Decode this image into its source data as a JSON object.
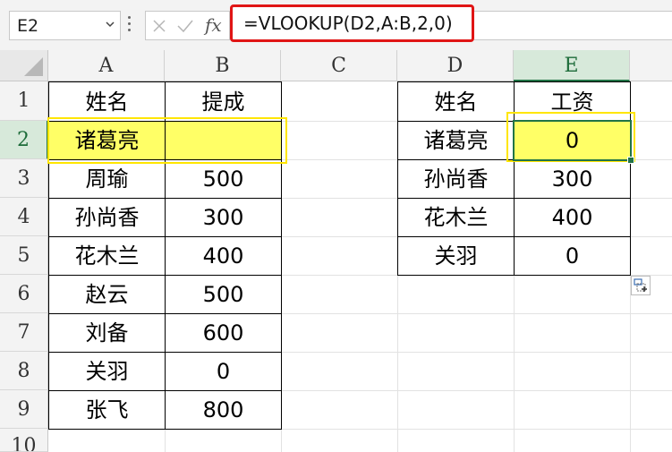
{
  "formula_bar": {
    "name_box": "E2",
    "fx_label": "fx",
    "formula": "=VLOOKUP(D2,A:B,2,0)"
  },
  "columns": [
    "A",
    "B",
    "C",
    "D",
    "E"
  ],
  "rows": [
    "1",
    "2",
    "3",
    "4",
    "5",
    "6",
    "7",
    "8",
    "9",
    "10"
  ],
  "table_left": {
    "headers": [
      "姓名",
      "提成"
    ],
    "rows": [
      [
        "诸葛亮",
        ""
      ],
      [
        "周瑜",
        "500"
      ],
      [
        "孙尚香",
        "300"
      ],
      [
        "花木兰",
        "400"
      ],
      [
        "赵云",
        "500"
      ],
      [
        "刘备",
        "600"
      ],
      [
        "关羽",
        "0"
      ],
      [
        "张飞",
        "800"
      ]
    ]
  },
  "table_right": {
    "headers": [
      "姓名",
      "工资"
    ],
    "rows": [
      [
        "诸葛亮",
        "0"
      ],
      [
        "孙尚香",
        "300"
      ],
      [
        "花木兰",
        "400"
      ],
      [
        "关羽",
        "0"
      ]
    ]
  },
  "colors": {
    "highlight": "#ffff66",
    "formula_outline": "#e01515",
    "selection": "#217346"
  }
}
